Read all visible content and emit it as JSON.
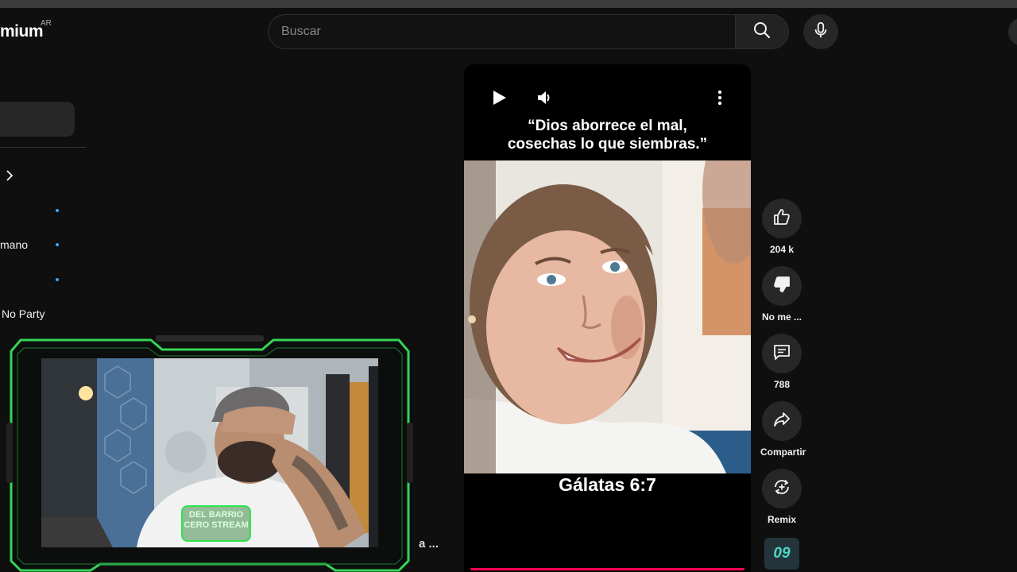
{
  "header": {
    "logo_text": "mium",
    "logo_region": "AR",
    "search_placeholder": "Buscar"
  },
  "sidebar": {
    "items": [
      {
        "label": "",
        "new_dot": true
      },
      {
        "label": "mano",
        "new_dot": true
      },
      {
        "label": "",
        "new_dot": true
      },
      {
        "label": "No Party",
        "new_dot": false
      }
    ]
  },
  "overlay": {
    "webcam_logo_text": "DEL BARRIO CERO STREAM",
    "behind_fragment": "a ..."
  },
  "short": {
    "quote_line1": "“Dios aborrece el mal,",
    "quote_line2": "cosechas lo que siembras.”",
    "verse": "Gálatas 6:7",
    "progress_color": "#ff0050"
  },
  "actions": {
    "like_count": "204 k",
    "dislike_label": "No me ...",
    "comments_count": "788",
    "share_label": "Compartir",
    "remix_label": "Remix",
    "channel_thumb_text": "09"
  }
}
